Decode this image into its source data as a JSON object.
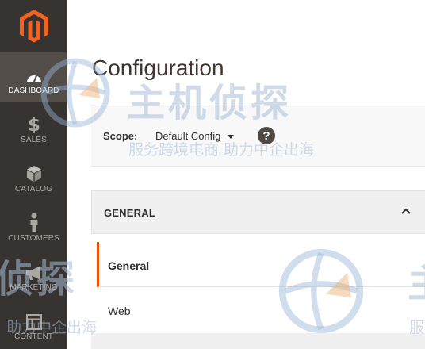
{
  "sidebar": {
    "items": [
      {
        "label": "DASHBOARD",
        "icon": "speedometer-icon",
        "active": true
      },
      {
        "label": "SALES",
        "icon": "dollar-icon",
        "active": false
      },
      {
        "label": "CATALOG",
        "icon": "box-icon",
        "active": false
      },
      {
        "label": "CUSTOMERS",
        "icon": "person-icon",
        "active": false
      },
      {
        "label": "MARKETING",
        "icon": "megaphone-icon",
        "active": false
      },
      {
        "label": "CONTENT",
        "icon": "layout-icon",
        "active": false
      }
    ]
  },
  "page": {
    "title": "Configuration"
  },
  "scope": {
    "label": "Scope:",
    "value": "Default Config",
    "help": "?"
  },
  "section": {
    "title": "GENERAL",
    "tabs": [
      {
        "label": "General",
        "active": true
      },
      {
        "label": "Web",
        "active": false
      }
    ]
  },
  "watermark": {
    "line1": "主机侦探",
    "line2": "服务跨境电商 助力中企出海",
    "line3": "侦探",
    "line4": "助力中企出海",
    "line5": "主",
    "line6": "服"
  },
  "colors": {
    "sidebar_bg": "#373330",
    "sidebar_active": "#524d49",
    "brand_orange": "#eb5202",
    "title_color": "#41362f"
  }
}
